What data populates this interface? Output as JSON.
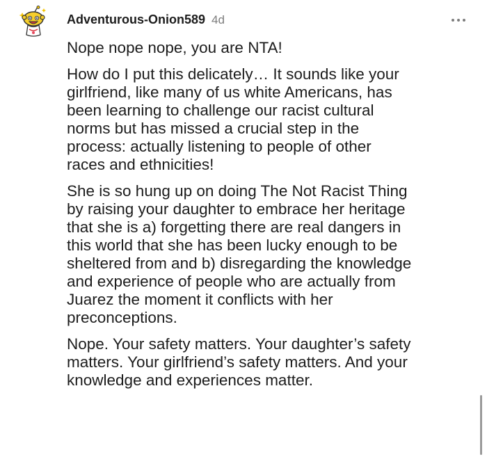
{
  "comment": {
    "avatar": {
      "icon": "snoo-avatar-icon"
    },
    "author": "Adventurous-Onion589",
    "age": "4d",
    "more_icon": "more-options-icon",
    "paragraphs": [
      {
        "lines": [
          "Nope nope nope, you are NTA!"
        ]
      },
      {
        "lines": [
          "How do I put this delicately… It sounds like your",
          "girlfriend, like many of us white Americans, has",
          "been learning to challenge our racist cultural",
          "norms but has missed a crucial step in the",
          "process: actually listening to people of other",
          "races and ethnicities!"
        ]
      },
      {
        "lines": [
          "She is so hung up on doing The Not Racist Thing",
          "by raising your daughter to embrace her heritage",
          "that she is a) forgetting there are real dangers in",
          "this world that she has been lucky enough to be",
          "sheltered from and b) disregarding the knowledge",
          "and experience of people who are actually from",
          "Juarez the moment it conflicts with her",
          "preconceptions."
        ]
      },
      {
        "lines": [
          "Nope. Your safety matters. Your daughter’s safety",
          "matters. Your girlfriend’s safety matters. And your",
          "knowledge and experiences matter."
        ]
      }
    ]
  }
}
